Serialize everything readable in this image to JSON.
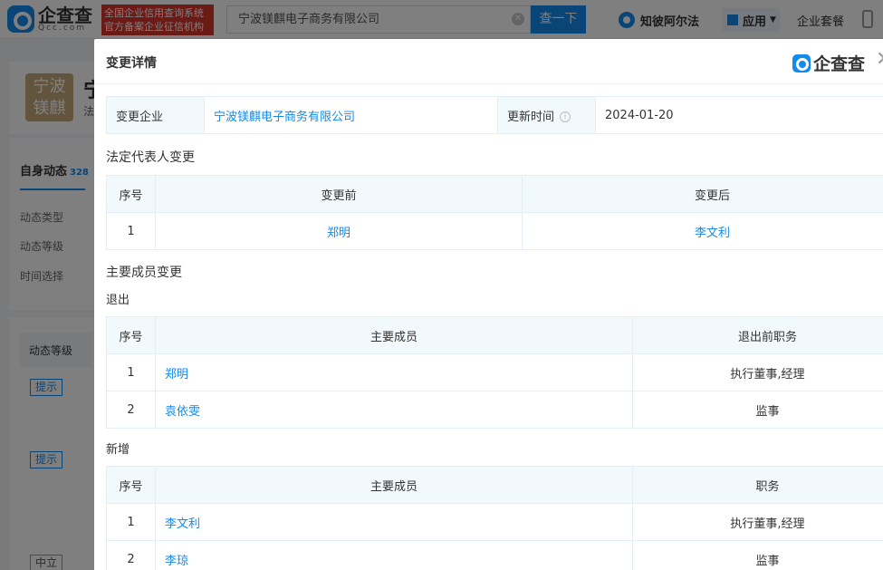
{
  "header": {
    "logo_text": "企查查",
    "logo_sub": "Qcc.com",
    "credit_badge_line1": "全国企业信用查询系统",
    "credit_badge_line2": "官方备案企业征信机构",
    "search_value": "宁波镁麒电子商务有限公司",
    "search_button": "查一下",
    "zhibi": "知彼阿尔法",
    "apps": "应用",
    "enterprise_package": "企业套餐"
  },
  "background": {
    "avatar_text": "宁波镁麒",
    "title_fragment": "宁",
    "sub_fragment": "法",
    "tab_label": "自身动态",
    "tab_count": "328",
    "filter_type": "动态类型",
    "filter_level": "动态等级",
    "filter_time": "时间选择",
    "table_head": "动态等级",
    "tag1": "提示",
    "tag2": "提示",
    "tag3": "中立"
  },
  "modal": {
    "title": "变更详情",
    "brand": "企查查",
    "info": {
      "company_label": "变更企业",
      "company_value": "宁波镁麒电子商务有限公司",
      "update_label": "更新时间",
      "update_value": "2024-01-20"
    },
    "legal_rep": {
      "title": "法定代表人变更",
      "headers": [
        "序号",
        "变更前",
        "变更后"
      ],
      "rows": [
        [
          "1",
          "郑明",
          "李文利"
        ]
      ]
    },
    "members": {
      "title": "主要成员变更",
      "exit_label": "退出",
      "exit_headers": [
        "序号",
        "主要成员",
        "退出前职务"
      ],
      "exit_rows": [
        [
          "1",
          "郑明",
          "执行董事,经理"
        ],
        [
          "2",
          "袁依雯",
          "监事"
        ]
      ],
      "new_label": "新增",
      "new_headers": [
        "序号",
        "主要成员",
        "职务"
      ],
      "new_rows": [
        [
          "1",
          "李文利",
          "执行董事,经理"
        ],
        [
          "2",
          "李琼",
          "监事"
        ]
      ]
    }
  }
}
